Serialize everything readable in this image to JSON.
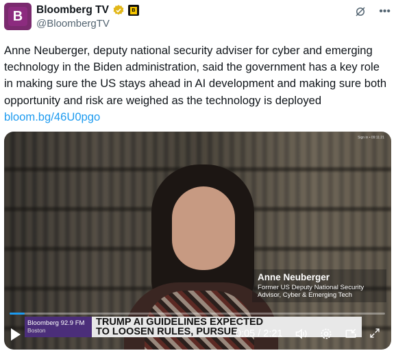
{
  "account": {
    "display_name": "Bloomberg TV",
    "handle": "@BloombergTV",
    "avatar_letter": "B",
    "affiliate_badge": "B",
    "verified_color": "#e2b719"
  },
  "header_icons": [
    "grok-icon",
    "more-icon"
  ],
  "tweet": {
    "text": "Anne Neuberger, deputy national security adviser for cyber and emerging technology in the Biden administration, said the government has a key role in making sure the US stays ahead in AI development and making sure both opportunity and risk are weighed as the technology is deployed ",
    "link": "bloom.bg/46U0pgo"
  },
  "video": {
    "lower_third_name": "Anne Neuberger",
    "lower_third_title": "Former US Deputy National Security Advisor, Cyber & Emerging Tech",
    "station": "Bloomberg 92.9 FM",
    "location": "Boston",
    "headline": "TRUMP AI GUIDELINES EXPECTED\nTO LOOSEN RULES, PURSUE",
    "time_display": "0:05 / 2:21",
    "progress": 0.04,
    "corner_text": "Sign in   •  09:11:21"
  },
  "colors": {
    "link": "#1d9bf0",
    "station_bar": "#4b2e7a",
    "avatar_bg": "#7a2a6e"
  }
}
